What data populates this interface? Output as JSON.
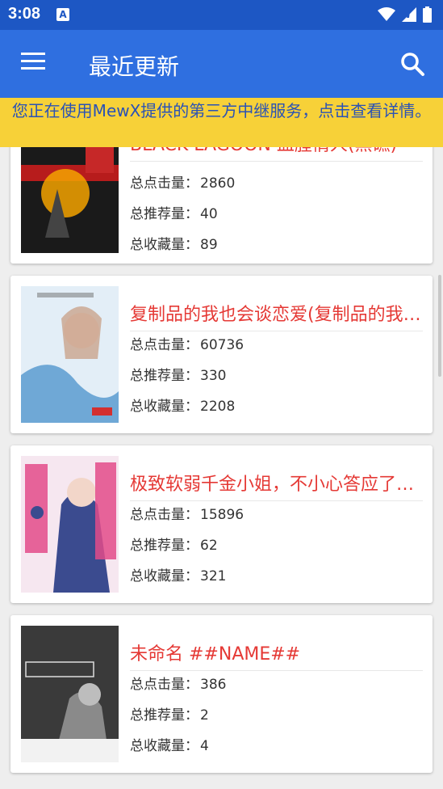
{
  "statusbar": {
    "time": "3:08",
    "notif_glyph": "A"
  },
  "appbar": {
    "title": "最近更新"
  },
  "banner": {
    "text": "您正在使用MewX提供的第三方中继服务，点击查看详情。"
  },
  "labels": {
    "clicks": "总点击量：",
    "recommends": "总推荐量：",
    "favorites": "总收藏量："
  },
  "novels": [
    {
      "title": "BLACK LAGOON 血腥情人(黑礁)",
      "clicks": "2860",
      "recommends": "40",
      "favorites": "89"
    },
    {
      "title": "复制品的我也会谈恋爱(复制品的我也会谈恋爱)",
      "clicks": "60736",
      "recommends": "330",
      "favorites": "2208"
    },
    {
      "title": "极致软弱千金小姐，不小心答应了与精明未婚夫的赌局",
      "clicks": "15896",
      "recommends": "62",
      "favorites": "321"
    },
    {
      "title": "未命名 ##NAME##",
      "clicks": "386",
      "recommends": "2",
      "favorites": "4"
    }
  ],
  "covers": [
    {
      "name": "cover-black-lagoon",
      "colors": [
        "#1a1a1a",
        "#b71c1c",
        "#f4a300"
      ]
    },
    {
      "name": "cover-replica",
      "colors": [
        "#e3eef7",
        "#6fa8d6",
        "#f6d3c6"
      ]
    },
    {
      "name": "cover-weak-lady",
      "colors": [
        "#f6e7f0",
        "#3b4b8f",
        "#e34b8a"
      ]
    },
    {
      "name": "cover-untitled",
      "colors": [
        "#2b2b2b",
        "#8a8a8a",
        "#dcdcdc"
      ]
    }
  ]
}
